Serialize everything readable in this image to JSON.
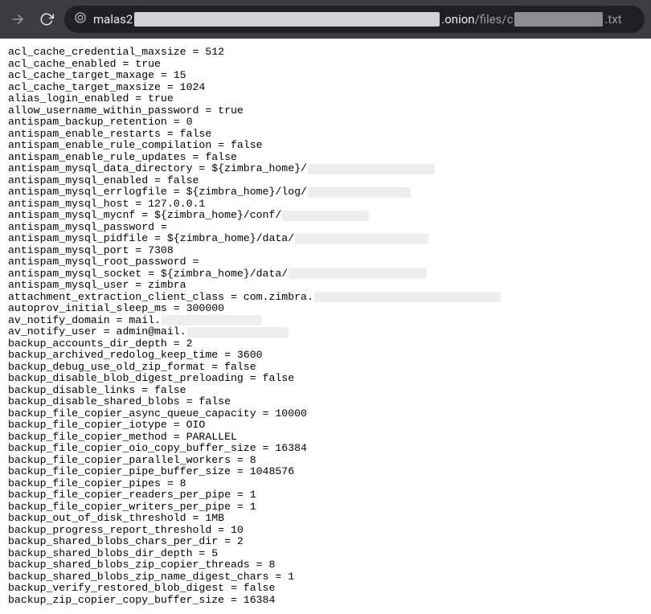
{
  "url": {
    "prefix": "malas2",
    "onion_label": ".onion",
    "path": "/files/c",
    "ext": ".txt"
  },
  "config_lines": [
    {
      "text": "acl_cache_credential_maxsize = 512"
    },
    {
      "text": "acl_cache_enabled = true"
    },
    {
      "text": "acl_cache_target_maxage = 15"
    },
    {
      "text": "acl_cache_target_maxsize = 1024"
    },
    {
      "text": "alias_login_enabled = true"
    },
    {
      "text": "allow_username_within_password = true"
    },
    {
      "text": "antispam_backup_retention = 0"
    },
    {
      "text": "antispam_enable_restarts = false"
    },
    {
      "text": "antispam_enable_rule_compilation = false"
    },
    {
      "text": "antispam_enable_rule_updates = false"
    },
    {
      "text": "antispam_mysql_data_directory = ${zimbra_home}/",
      "redact_width": 158
    },
    {
      "text": "antispam_mysql_enabled = false"
    },
    {
      "text": "antispam_mysql_errlogfile = ${zimbra_home}/log/",
      "redact_width": 128
    },
    {
      "text": "antispam_mysql_host = 127.0.0.1"
    },
    {
      "text": "antispam_mysql_mycnf = ${zimbra_home}/conf/",
      "redact_width": 108
    },
    {
      "text": "antispam_mysql_password ="
    },
    {
      "text": "antispam_mysql_pidfile = ${zimbra_home}/data/",
      "redact_width": 166
    },
    {
      "text": "antispam_mysql_port = 7308"
    },
    {
      "text": "antispam_mysql_root_password ="
    },
    {
      "text": "antispam_mysql_socket = ${zimbra_home}/data/",
      "redact_width": 172
    },
    {
      "text": "antispam_mysql_user = zimbra"
    },
    {
      "text": "attachment_extraction_client_class = com.zimbra.",
      "redact_width": 232
    },
    {
      "text": "autoprov_initial_sleep_ms = 300000"
    },
    {
      "text": "av_notify_domain = mail.",
      "redact_width": 124
    },
    {
      "text": "av_notify_user = admin@mail.",
      "redact_width": 126
    },
    {
      "text": "backup_accounts_dir_depth = 2"
    },
    {
      "text": "backup_archived_redolog_keep_time = 3600"
    },
    {
      "text": "backup_debug_use_old_zip_format = false"
    },
    {
      "text": "backup_disable_blob_digest_preloading = false"
    },
    {
      "text": "backup_disable_links = false"
    },
    {
      "text": "backup_disable_shared_blobs = false"
    },
    {
      "text": "backup_file_copier_async_queue_capacity = 10000"
    },
    {
      "text": "backup_file_copier_iotype = OIO"
    },
    {
      "text": "backup_file_copier_method = PARALLEL"
    },
    {
      "text": "backup_file_copier_oio_copy_buffer_size = 16384"
    },
    {
      "text": "backup_file_copier_parallel_workers = 8"
    },
    {
      "text": "backup_file_copier_pipe_buffer_size = 1048576"
    },
    {
      "text": "backup_file_copier_pipes = 8"
    },
    {
      "text": "backup_file_copier_readers_per_pipe = 1"
    },
    {
      "text": "backup_file_copier_writers_per_pipe = 1"
    },
    {
      "text": "backup_out_of_disk_threshold = 1MB"
    },
    {
      "text": "backup_progress_report_threshold = 10"
    },
    {
      "text": "backup_shared_blobs_chars_per_dir = 2"
    },
    {
      "text": "backup_shared_blobs_dir_depth = 5"
    },
    {
      "text": "backup_shared_blobs_zip_copier_threads = 8"
    },
    {
      "text": "backup_shared_blobs_zip_name_digest_chars = 1"
    },
    {
      "text": "backup_verify_restored_blob_digest = false"
    },
    {
      "text": "backup_zip_copier_copy_buffer_size = 16384"
    }
  ]
}
